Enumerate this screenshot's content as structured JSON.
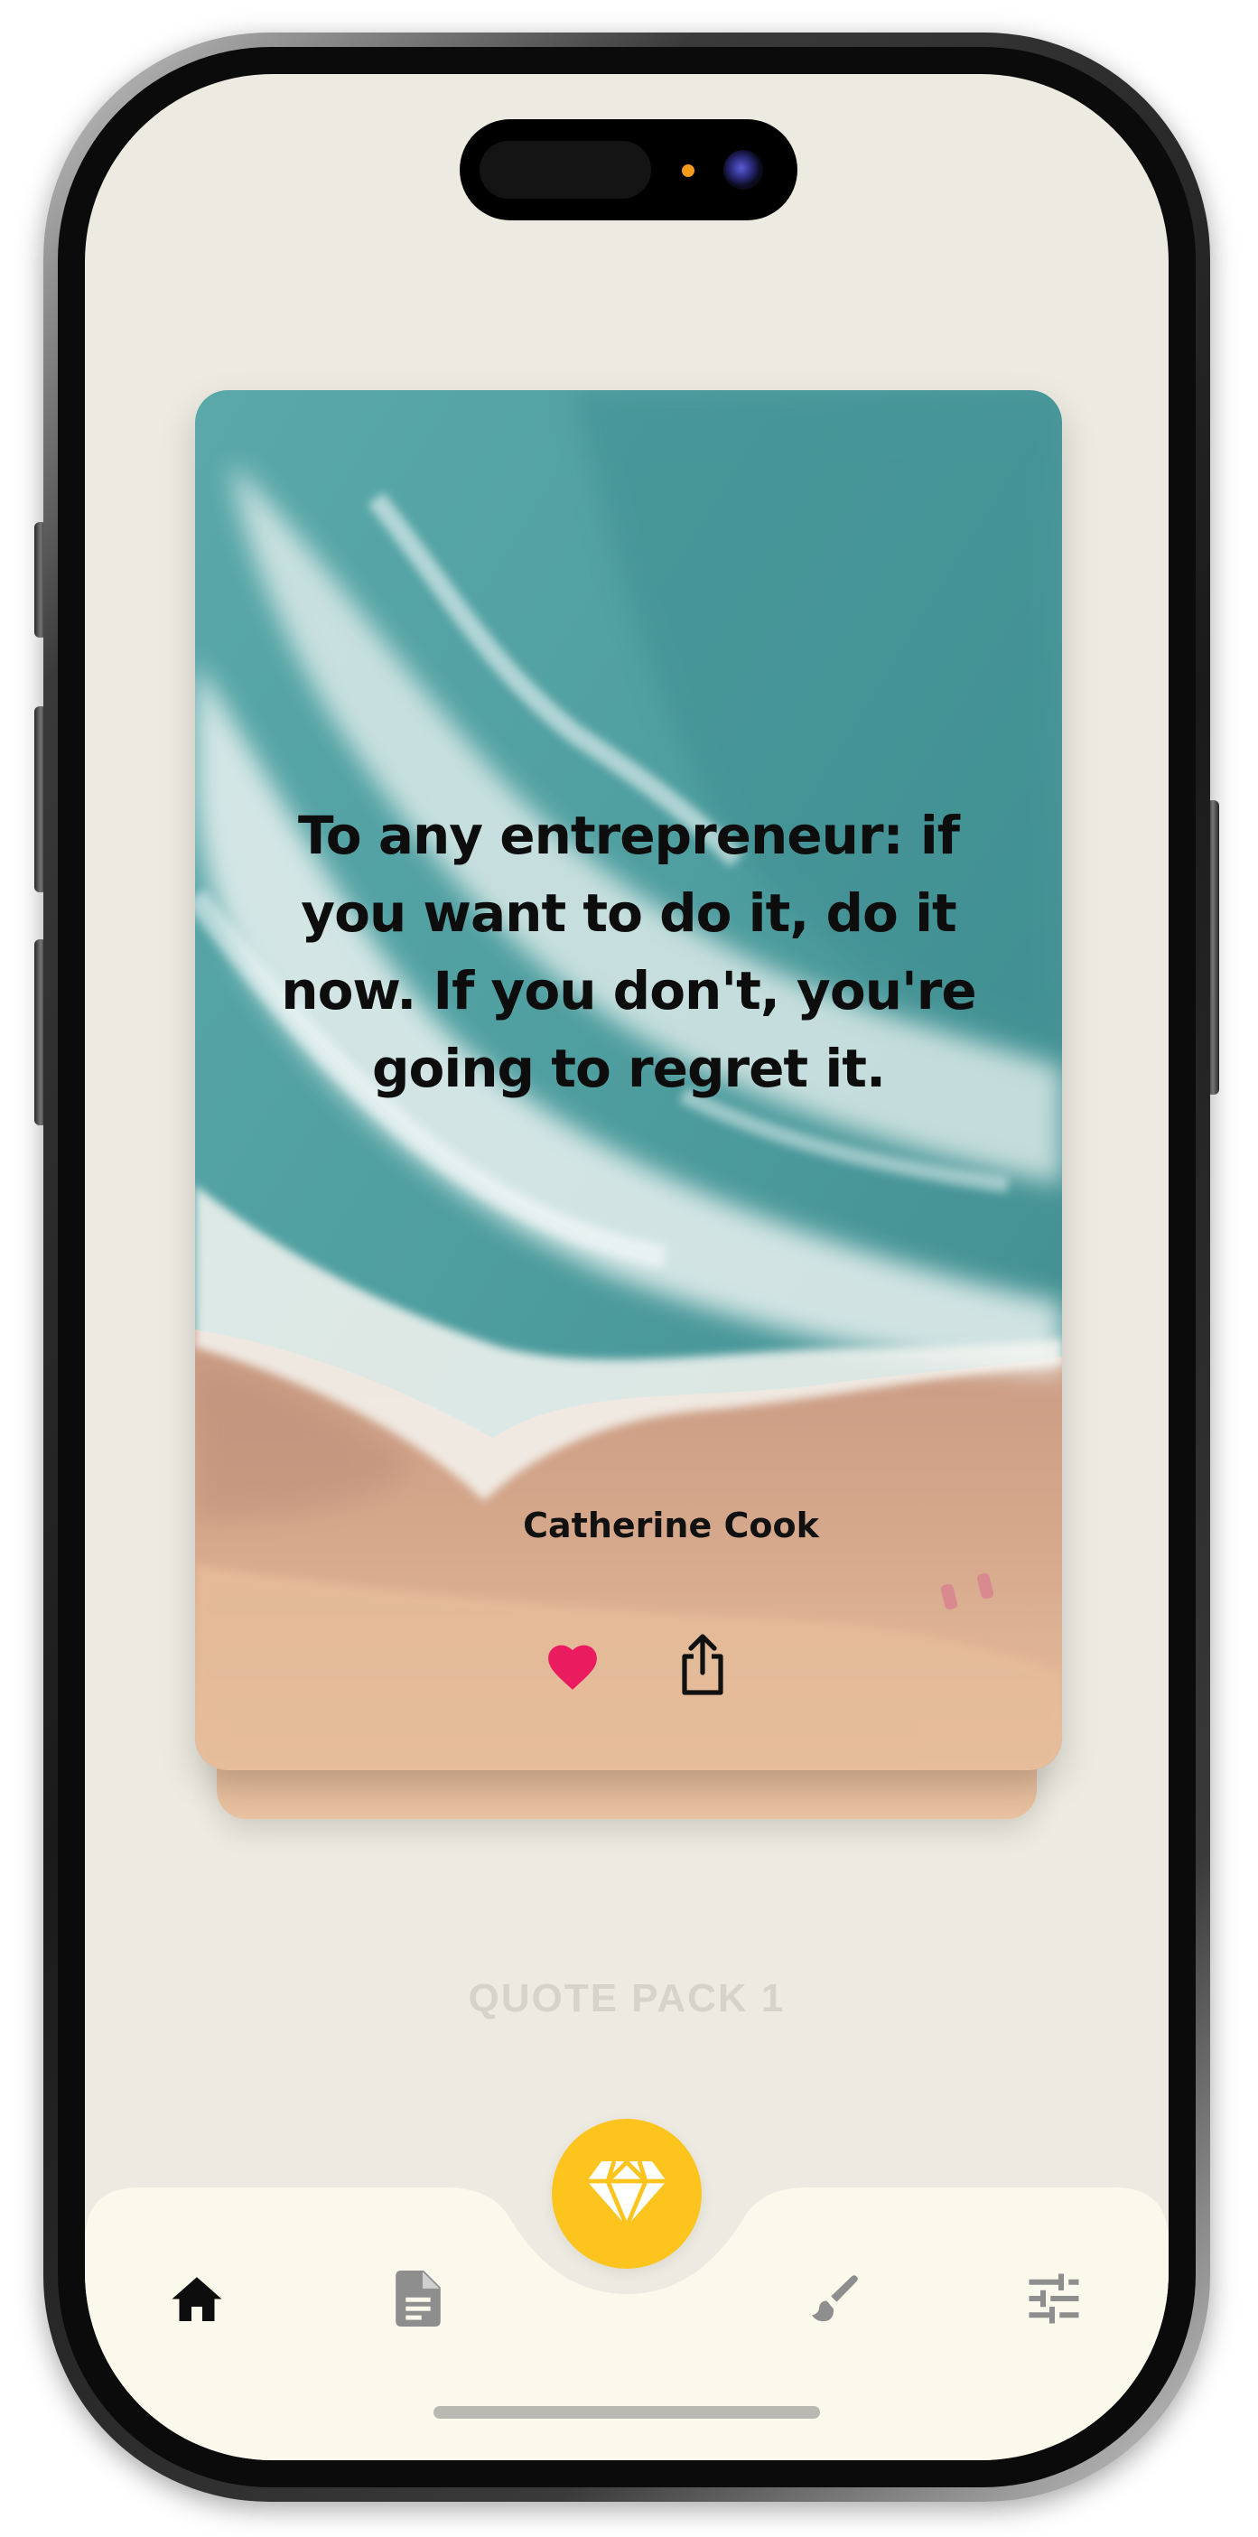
{
  "colors": {
    "screen_background": "#edebe1",
    "nav_background": "#fbf9ec",
    "premium_accent": "#fcc41c",
    "like_active": "#ea1c5f",
    "pack_label": "#d6d3cb"
  },
  "quote_card": {
    "text": "To any entrepreneur: if you want to do it, do it now. If you don't, you're going to regret it.",
    "author": "Catherine Cook",
    "liked": true,
    "actions": {
      "like_icon": "heart-icon",
      "share_icon": "share-icon"
    }
  },
  "pack": {
    "label": "QUOTE PACK 1"
  },
  "bottom_nav": {
    "items": [
      {
        "id": "home",
        "icon": "home-icon",
        "active": true
      },
      {
        "id": "quotes",
        "icon": "document-icon",
        "active": false
      },
      {
        "id": "themes",
        "icon": "brush-icon",
        "active": false
      },
      {
        "id": "settings",
        "icon": "sliders-icon",
        "active": false
      }
    ],
    "center_button_icon": "diamond-icon"
  }
}
